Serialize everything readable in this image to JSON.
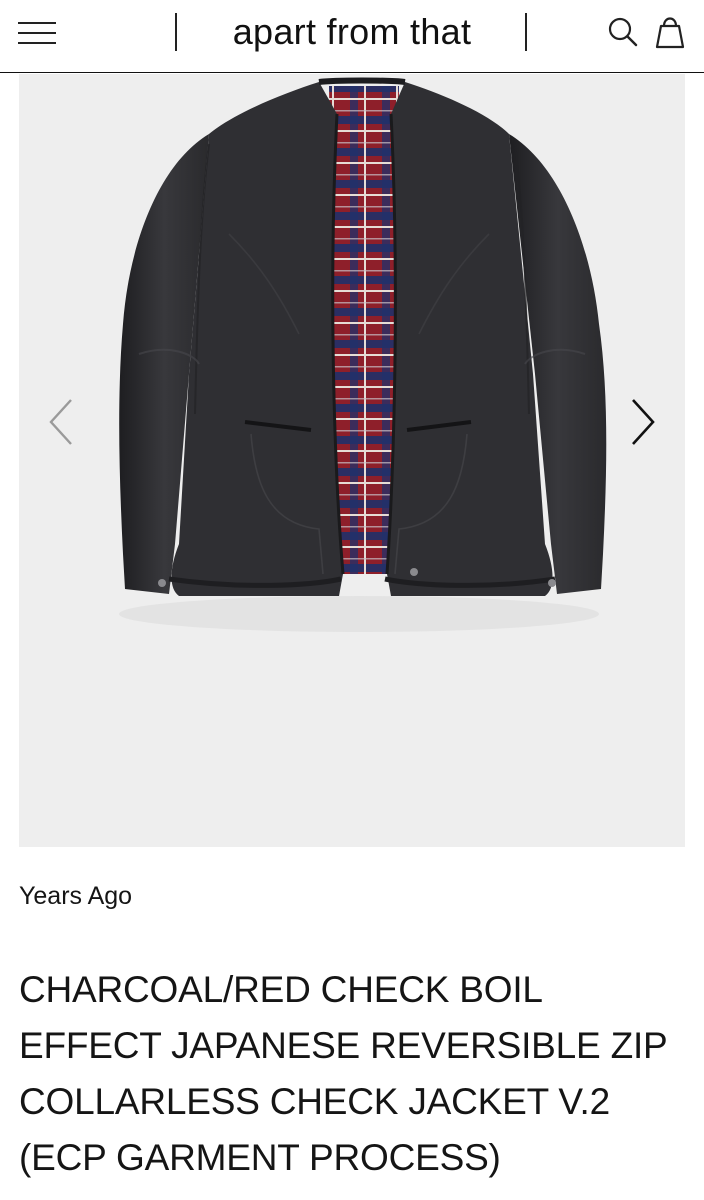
{
  "header": {
    "brand": "apart from that",
    "menu_icon": "hamburger-menu-icon",
    "search_icon": "search-icon",
    "bag_icon": "shopping-bag-icon"
  },
  "gallery": {
    "prev_icon": "chevron-left-icon",
    "next_icon": "chevron-right-icon",
    "image_alt": "CHARCOAL/RED CHECK BOIL EFFECT JAPANESE REVERSIBLE ZIP COLLARLESS CHECK JACKET V.2 (ECP GARMENT PROCESS)"
  },
  "product": {
    "label": "Years Ago",
    "title": "CHARCOAL/RED CHECK BOIL EFFECT JAPANESE REVERSIBLE ZIP COLLARLESS CHECK JACKET V.2 (ECP GARMENT PROCESS)"
  },
  "colors": {
    "background": "#ffffff",
    "image_bg": "#eeeeee",
    "text": "#151515",
    "jacket": "#2e2e31",
    "check_red": "#8e1f2a",
    "check_navy": "#20306a"
  }
}
